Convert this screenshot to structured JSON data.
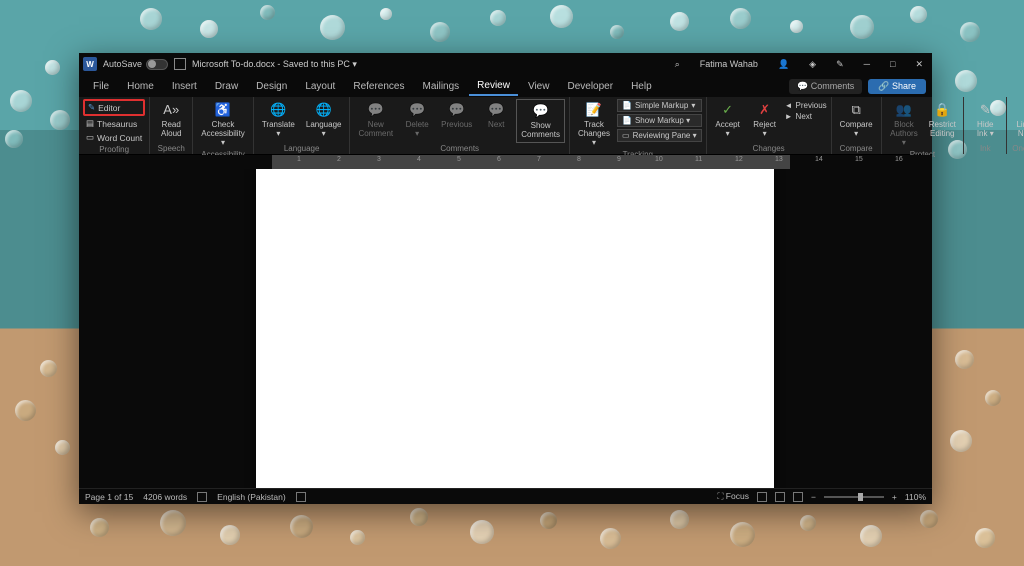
{
  "titlebar": {
    "autosave_label": "AutoSave",
    "autosave_state": "Off",
    "doc_title": "Microsoft To-do.docx - Saved to this PC ▾",
    "user_name": "Fatima Wahab"
  },
  "tabs": {
    "items": [
      "File",
      "Home",
      "Insert",
      "Draw",
      "Design",
      "Layout",
      "References",
      "Mailings",
      "Review",
      "View",
      "Developer",
      "Help"
    ],
    "active": "Review",
    "comments_label": "💬 Comments",
    "share_label": "Share"
  },
  "ribbon": {
    "proofing": {
      "editor": "Editor",
      "thesaurus": "Thesaurus",
      "word_count": "Word Count",
      "group_label": "Proofing"
    },
    "speech": {
      "read_aloud": "Read\nAloud",
      "group_label": "Speech"
    },
    "accessibility": {
      "check": "Check\nAccessibility ▾",
      "group_label": "Accessibility"
    },
    "language": {
      "translate": "Translate\n▾",
      "language": "Language\n▾",
      "group_label": "Language"
    },
    "comments": {
      "new": "New\nComment",
      "delete": "Delete\n▾",
      "previous": "Previous",
      "next": "Next",
      "show": "Show\nComments",
      "group_label": "Comments"
    },
    "tracking": {
      "track": "Track\nChanges ▾",
      "simple_markup": "Simple Markup",
      "show_markup": "Show Markup ▾",
      "reviewing_pane": "Reviewing Pane ▾",
      "group_label": "Tracking"
    },
    "changes": {
      "accept": "Accept\n▾",
      "reject": "Reject\n▾",
      "previous": "Previous",
      "next": "Next",
      "group_label": "Changes"
    },
    "compare": {
      "compare": "Compare\n▾",
      "group_label": "Compare"
    },
    "protect": {
      "block": "Block\nAuthors ▾",
      "restrict": "Restrict\nEditing",
      "group_label": "Protect"
    },
    "ink": {
      "hide": "Hide\nInk ▾",
      "group_label": "Ink"
    },
    "onenote": {
      "linked": "Linked\nNotes",
      "group_label": "OneNote"
    }
  },
  "statusbar": {
    "page_info": "Page 1 of 15",
    "word_count": "4206 words",
    "language": "English (Pakistan)",
    "focus": "Focus",
    "zoom": "110%"
  },
  "colors": {
    "highlight": "#e03030",
    "share": "#2b6cb0",
    "active_tab": "#4a8fd8"
  }
}
